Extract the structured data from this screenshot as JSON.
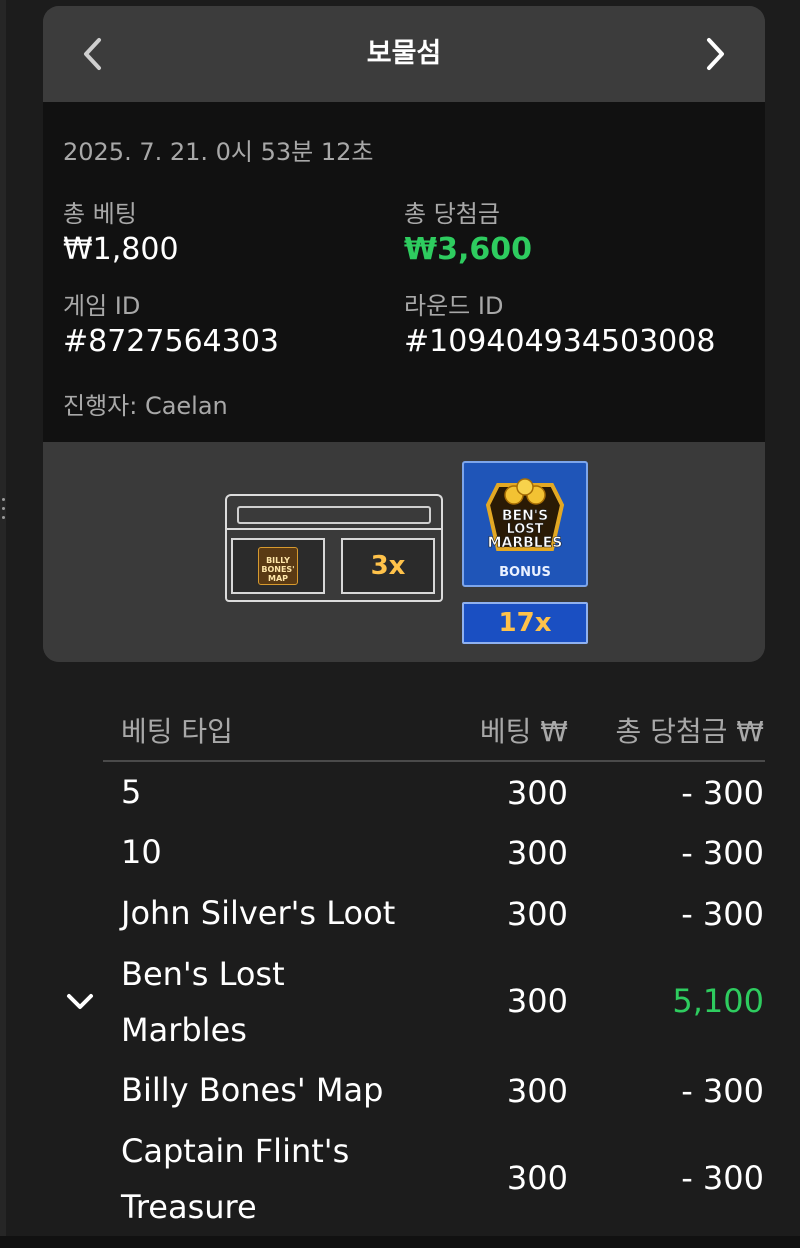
{
  "header": {
    "title": "보물섬"
  },
  "details": {
    "datetime": "2025. 7. 21. 0시 53분 12초",
    "total_bet_label": "총 베팅",
    "total_bet_value": "₩1,800",
    "total_win_label": "총 당첨금",
    "total_win_value": "₩3,600",
    "game_id_label": "게임 ID",
    "game_id_value": "#8727564303",
    "round_id_label": "라운드 ID",
    "round_id_value": "#109404934503008",
    "host": "진행자: Caelan"
  },
  "result": {
    "chest_slots": [
      {
        "kind": "Billy Bones' Map",
        "label": "BILLY BONES' MAP"
      },
      {
        "kind": "multiplier",
        "label": "3x"
      }
    ],
    "bonus": {
      "logo_text_1": "BEN'S",
      "logo_text_2": "LOST",
      "logo_text_3": "MARBLES",
      "label": "BONUS",
      "multiplier": "17x"
    }
  },
  "table": {
    "col_type": "베팅 타입",
    "col_bet": "베팅 ₩",
    "col_win": "총 당첨금 ₩",
    "rows": [
      {
        "type": "5",
        "bet": "300",
        "win": "- 300"
      },
      {
        "type": "10",
        "bet": "300",
        "win": "- 300"
      },
      {
        "type": "John Silver's Loot",
        "bet": "300",
        "win": "- 300"
      },
      {
        "type": "Ben's Lost Marbles",
        "type_line1": "Ben's Lost",
        "type_line2": "Marbles",
        "bet": "300",
        "win": "5,100",
        "expanded_chevron": "chevron-down-icon"
      },
      {
        "type": "Billy Bones' Map",
        "bet": "300",
        "win": "- 300"
      },
      {
        "type": "Captain Flint's Treasure",
        "type_line1": "Captain Flint's",
        "type_line2": "Treasure",
        "bet": "300",
        "win": "- 300"
      }
    ]
  },
  "colors": {
    "win_green": "#2ecc5f",
    "multiplier_gold": "#ffc24a",
    "bonus_blue": "#1f55b8"
  }
}
